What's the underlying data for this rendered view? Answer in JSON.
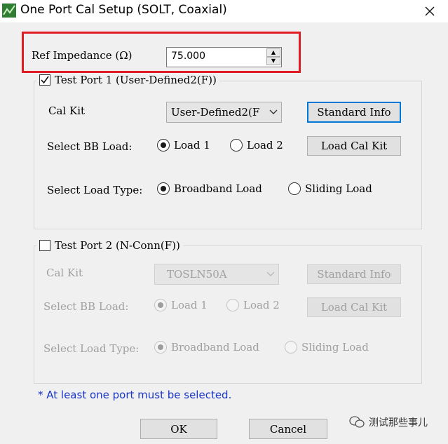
{
  "window": {
    "title": "One Port Cal Setup (SOLT, Coaxial)"
  },
  "ref_impedance": {
    "label": "Ref Impedance (Ω)",
    "value": "75.000"
  },
  "port1": {
    "legend": "Test Port 1 (User-Defined2(F))",
    "checked": true,
    "cal_kit_label": "Cal Kit",
    "cal_kit_value": "User-Defined2(F",
    "standard_info_label": "Standard Info",
    "bb_load_label": "Select BB Load:",
    "load1_label": "Load 1",
    "load2_label": "Load 2",
    "load_cal_kit_label": "Load Cal Kit",
    "load_type_label": "Select Load Type:",
    "broadband_label": "Broadband Load",
    "sliding_label": "Sliding Load"
  },
  "port2": {
    "legend": "Test Port 2 (N-Conn(F))",
    "checked": false,
    "cal_kit_label": "Cal Kit",
    "cal_kit_value": "TOSLN50A",
    "standard_info_label": "Standard Info",
    "bb_load_label": "Select BB Load:",
    "load1_label": "Load 1",
    "load2_label": "Load 2",
    "load_cal_kit_label": "Load Cal Kit",
    "load_type_label": "Select Load Type:",
    "broadband_label": "Broadband Load",
    "sliding_label": "Sliding Load"
  },
  "note": "* At least one port must be selected.",
  "buttons": {
    "ok": "OK",
    "cancel": "Cancel"
  },
  "watermark": {
    "text": "测试那些事儿",
    "icon": "wechat-icon"
  },
  "colors": {
    "highlight": "#e11b24",
    "note": "#1a36c9",
    "focus": "#0078d7"
  }
}
